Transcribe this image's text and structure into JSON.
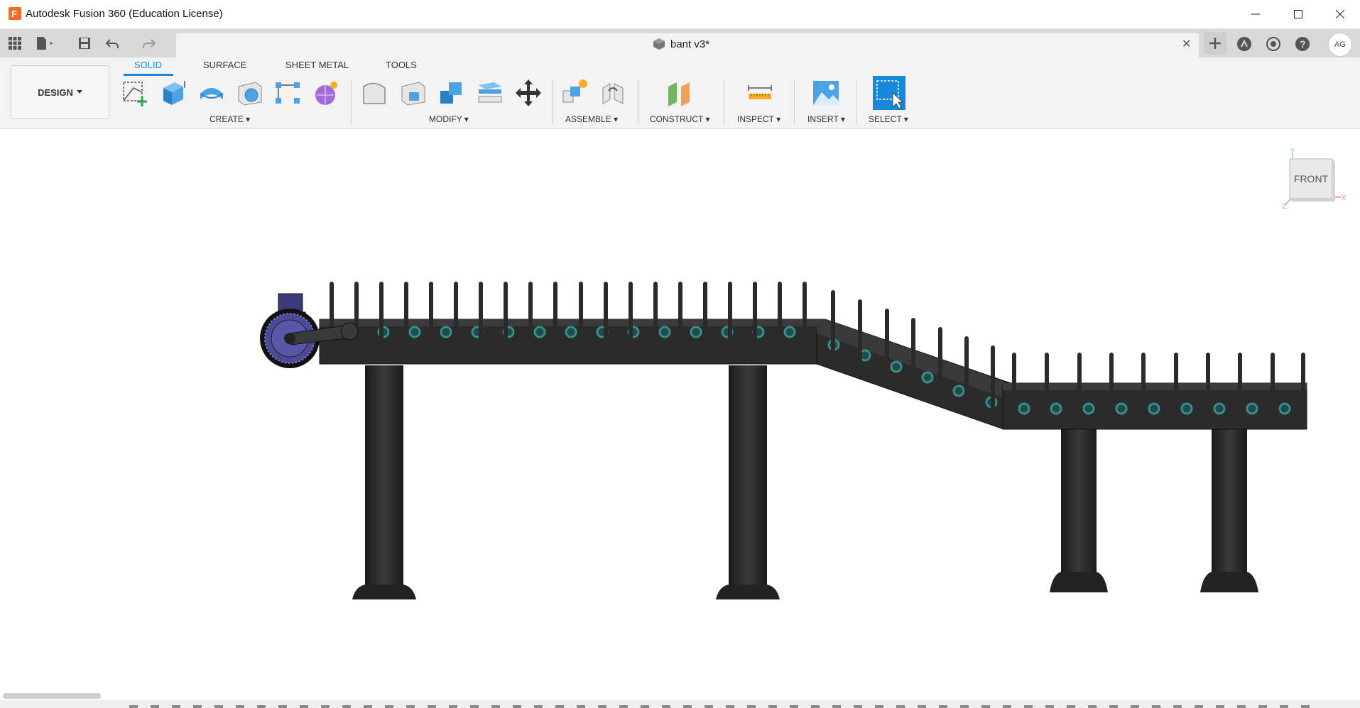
{
  "window": {
    "title": "Autodesk Fusion 360 (Education License)",
    "logo_letter": "F",
    "controls": [
      "minimize",
      "maximize",
      "close"
    ]
  },
  "quick_access": {
    "icons": [
      "grid-icon",
      "file-icon",
      "save-icon",
      "undo-icon",
      "redo-icon"
    ]
  },
  "document_tab": {
    "title": "bant v3*",
    "close": "✕"
  },
  "header_right": {
    "icons": [
      "new-tab-icon",
      "extensions-icon",
      "job-status-icon",
      "help-icon"
    ],
    "avatar": "AG"
  },
  "toolbar": {
    "workspace": "DESIGN",
    "tabs": [
      "SOLID",
      "SURFACE",
      "SHEET METAL",
      "TOOLS"
    ],
    "active_tab": "SOLID",
    "groups": {
      "create": "CREATE",
      "modify": "MODIFY",
      "assemble": "ASSEMBLE",
      "construct": "CONSTRUCT",
      "inspect": "INSPECT",
      "insert": "INSERT",
      "select": "SELECT"
    },
    "accent": "#1e8ad6"
  },
  "viewcube": {
    "face": "FRONT",
    "axes": {
      "y": "Y",
      "x": "X",
      "z": "Z"
    }
  }
}
